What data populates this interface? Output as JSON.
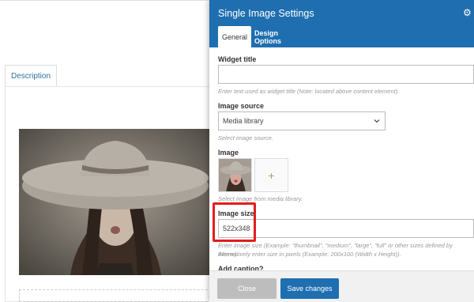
{
  "editor": {
    "description_tab": "Description"
  },
  "modal": {
    "title": "Single Image Settings",
    "tabs": [
      {
        "label": "General",
        "active": true
      },
      {
        "label": "Design Options",
        "active": false
      }
    ],
    "fields": {
      "widget_title": {
        "label": "Widget title",
        "value": "",
        "help": "Enter text used as widget title (Note: located above content element)."
      },
      "image_source": {
        "label": "Image source",
        "value": "Media library",
        "help": "Select image source."
      },
      "image": {
        "label": "Image",
        "add_symbol": "+",
        "help": "Select image from media library."
      },
      "image_size": {
        "label": "Image size",
        "value": "522x348",
        "help_line1": "Enter image size (Example: \"thumbnail\", \"medium\", \"large\", \"full\" or other sizes defined by theme).",
        "help_line2": "Alternatively enter size in pixels (Example: 200x100 (Width x Height))."
      },
      "add_caption": {
        "label": "Add caption?"
      }
    },
    "buttons": {
      "close": "Close",
      "save": "Save changes"
    }
  },
  "colors": {
    "header": "#1f6fb0",
    "highlight": "#e01e1e",
    "plus": "#7ab85a"
  },
  "icons": [
    "gear-icon",
    "chevron-down-icon",
    "add-icon"
  ]
}
